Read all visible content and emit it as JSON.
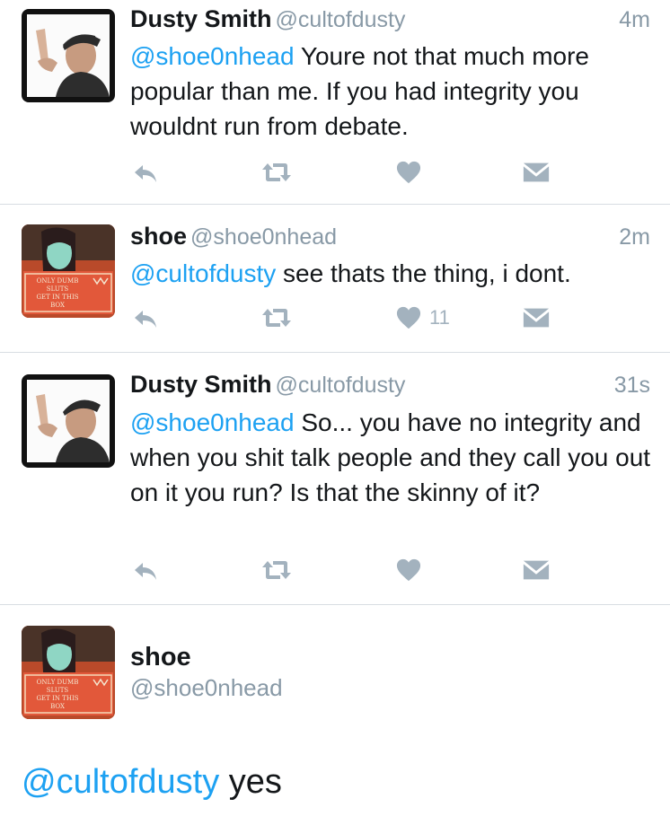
{
  "tweets": [
    {
      "name": "Dusty Smith",
      "handle": "@cultofdusty",
      "time": "4m",
      "mention": "@shoe0nhead",
      "text": " Youre not that much more popular than me. If you had integrity you wouldnt run from debate.",
      "like_count": ""
    },
    {
      "name": "shoe",
      "handle": "@shoe0nhead",
      "time": "2m",
      "mention": "@cultofdusty",
      "text": " see thats the thing, i dont.",
      "like_count": "11"
    },
    {
      "name": "Dusty Smith",
      "handle": "@cultofdusty",
      "time": "31s",
      "mention": "@shoe0nhead",
      "text": " So... you have no integrity and when you shit talk people and they call you out on it you run? Is that the skinny of it?",
      "like_count": ""
    }
  ],
  "detail": {
    "name": "shoe",
    "handle": "@shoe0nhead",
    "mention": "@cultofdusty",
    "text": " yes"
  },
  "avatar_box_text": [
    "ONLY DUMB",
    "SLUTS",
    "GET IN THIS",
    "BOX"
  ],
  "icons": {
    "reply": "reply-icon",
    "retweet": "retweet-icon",
    "like": "heart-icon",
    "message": "direct-message-icon"
  },
  "colors": {
    "mention": "#1da1f2",
    "secondary_text": "#8899a6",
    "action_icon": "#a3b2be",
    "divider": "#d8dde2"
  }
}
